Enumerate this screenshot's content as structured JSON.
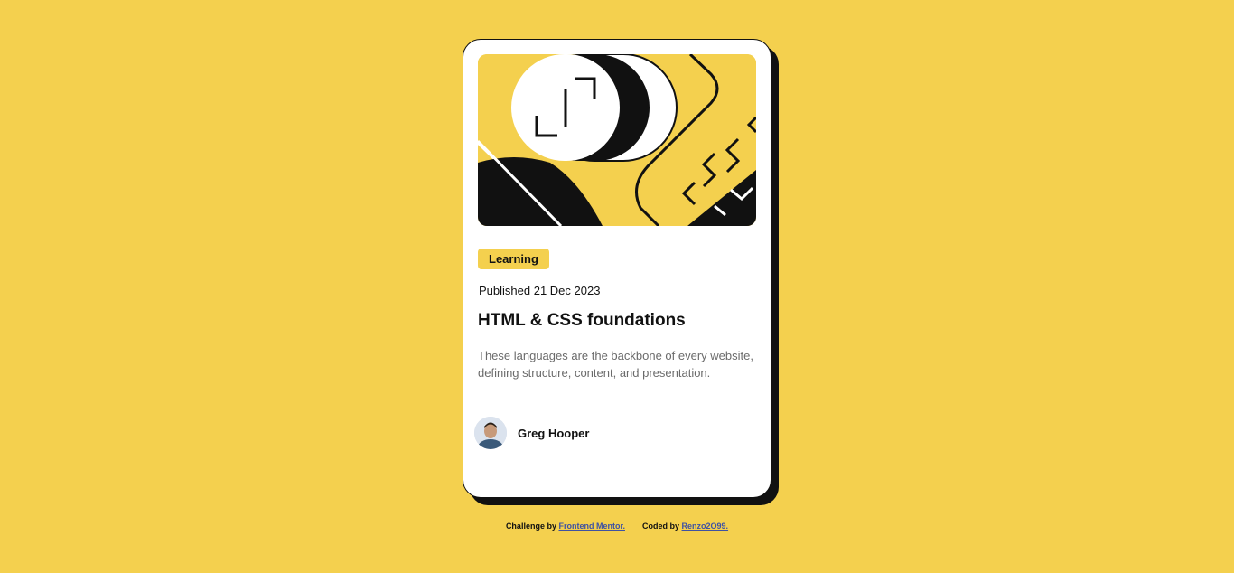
{
  "colors": {
    "background": "#f4d04e",
    "card": "#ffffff",
    "ink": "#111111",
    "muted": "#6b6b6b",
    "link": "#3e52a3"
  },
  "card": {
    "hero_image": "illustration-article",
    "tag": "Learning",
    "published": "Published 21 Dec 2023",
    "title": "HTML & CSS foundations",
    "description": "These languages are the backbone of every website, defining structure, content, and presentation.",
    "author": {
      "avatar": "avatar-image",
      "name": "Greg Hooper"
    }
  },
  "attribution": {
    "challenge_prefix": "Challenge by",
    "challenge_link": "Frontend Mentor.",
    "coded_prefix": "Coded by",
    "coded_link": "Renzo2O99."
  }
}
